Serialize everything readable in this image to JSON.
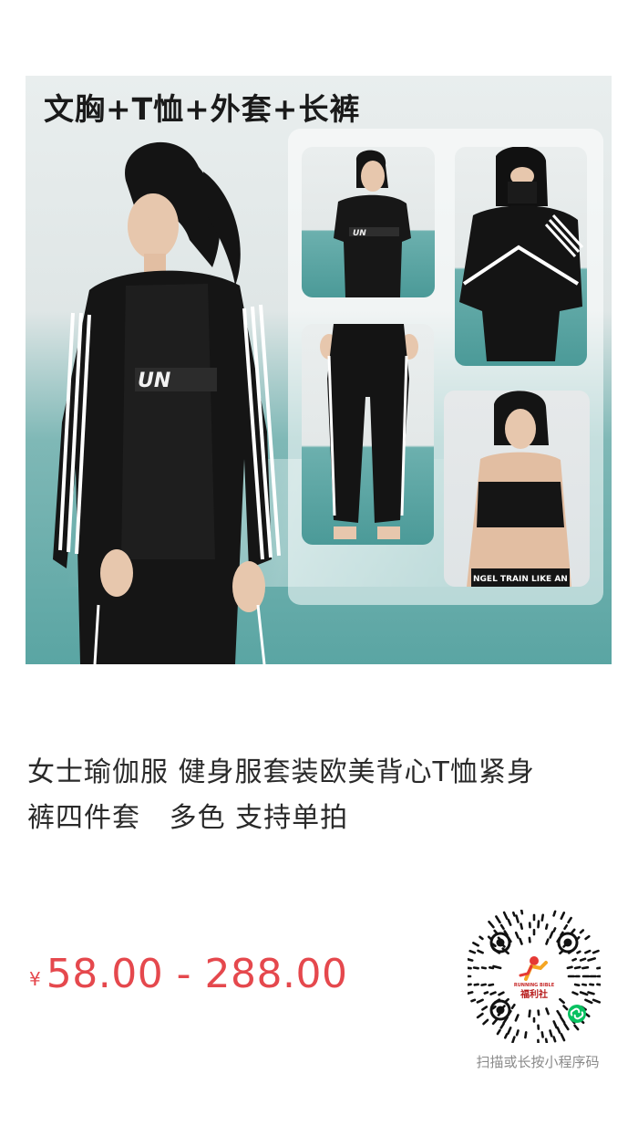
{
  "product": {
    "image": {
      "banner_text": "文胸+T恤+外套+长裤",
      "print_text_tee": "UN",
      "print_text_waistband": "NGEL TRAIN LIKE AN",
      "colors": {
        "wall": "#e3e8e8",
        "floor_teal": "#5aa5a3",
        "garment_black": "#151515",
        "stripe_white": "#ffffff"
      }
    },
    "title": {
      "line1": "女士瑜伽服 健身服套装欧美背心T恤紧身",
      "line2": "裤四件套   多色 支持单拍"
    },
    "price": {
      "currency": "¥",
      "range": "58.00 - 288.00",
      "color": "#e5484d"
    }
  },
  "mini_program": {
    "logo_text_top": "RUNNING BIBLE",
    "logo_text_cn": "福利社",
    "caption": "扫描或长按小程序码",
    "icon": "mini-program-link-icon",
    "accent": "#07c160"
  }
}
